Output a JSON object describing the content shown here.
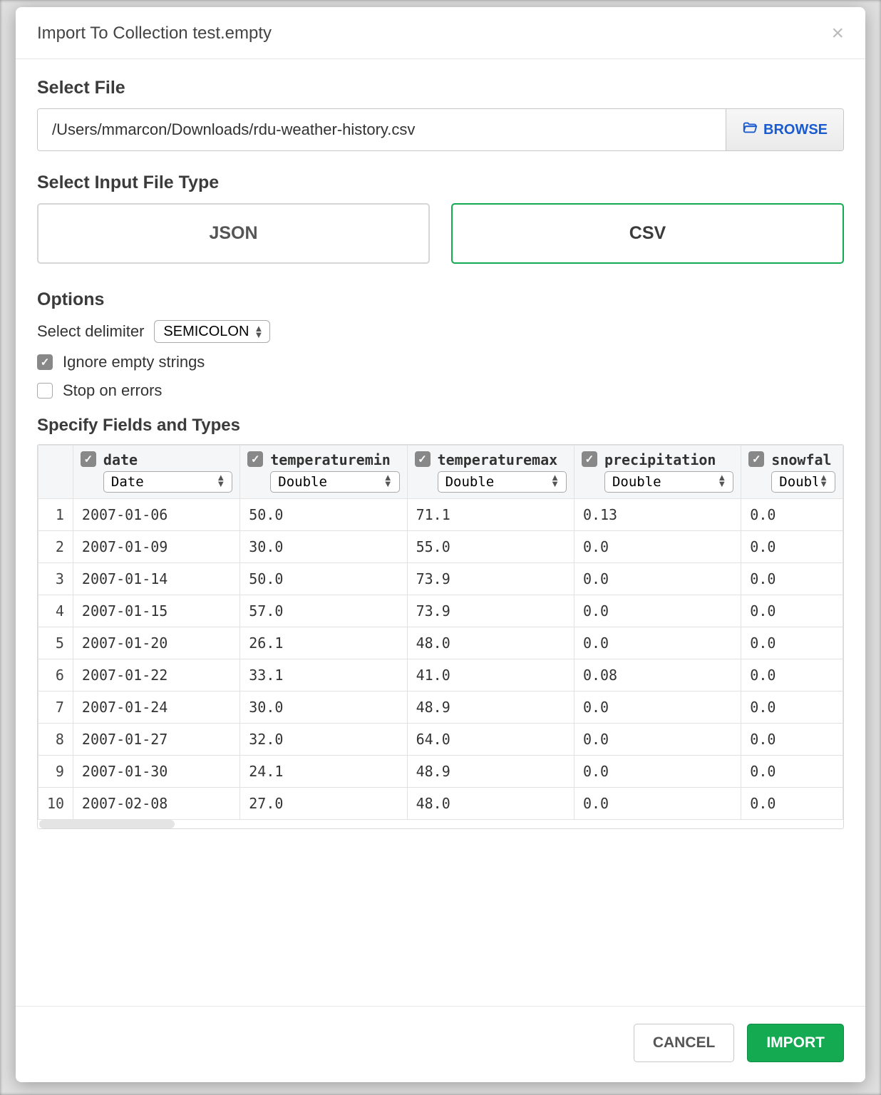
{
  "modal": {
    "title": "Import To Collection test.empty"
  },
  "file": {
    "label": "Select File",
    "path": "/Users/mmarcon/Downloads/rdu-weather-history.csv",
    "browse": "BROWSE"
  },
  "filetype": {
    "label": "Select Input File Type",
    "json": "JSON",
    "csv": "CSV",
    "selected": "csv"
  },
  "options": {
    "label": "Options",
    "delimiter_label": "Select delimiter",
    "delimiter_value": "SEMICOLON",
    "ignore_empty_label": "Ignore empty strings",
    "ignore_empty_checked": true,
    "stop_on_errors_label": "Stop on errors",
    "stop_on_errors_checked": false
  },
  "fields": {
    "label": "Specify Fields and Types",
    "columns": [
      {
        "name": "date",
        "type": "Date",
        "checked": true
      },
      {
        "name": "temperaturemin",
        "type": "Double",
        "checked": true
      },
      {
        "name": "temperaturemax",
        "type": "Double",
        "checked": true
      },
      {
        "name": "precipitation",
        "type": "Double",
        "checked": true
      },
      {
        "name": "snowfal",
        "type": "Doubl",
        "checked": true
      }
    ],
    "rows": [
      [
        "2007-01-06",
        "50.0",
        "71.1",
        "0.13",
        "0.0"
      ],
      [
        "2007-01-09",
        "30.0",
        "55.0",
        "0.0",
        "0.0"
      ],
      [
        "2007-01-14",
        "50.0",
        "73.9",
        "0.0",
        "0.0"
      ],
      [
        "2007-01-15",
        "57.0",
        "73.9",
        "0.0",
        "0.0"
      ],
      [
        "2007-01-20",
        "26.1",
        "48.0",
        "0.0",
        "0.0"
      ],
      [
        "2007-01-22",
        "33.1",
        "41.0",
        "0.08",
        "0.0"
      ],
      [
        "2007-01-24",
        "30.0",
        "48.9",
        "0.0",
        "0.0"
      ],
      [
        "2007-01-27",
        "32.0",
        "64.0",
        "0.0",
        "0.0"
      ],
      [
        "2007-01-30",
        "24.1",
        "48.9",
        "0.0",
        "0.0"
      ],
      [
        "2007-02-08",
        "27.0",
        "48.0",
        "0.0",
        "0.0"
      ]
    ]
  },
  "footer": {
    "cancel": "CANCEL",
    "import": "IMPORT"
  }
}
